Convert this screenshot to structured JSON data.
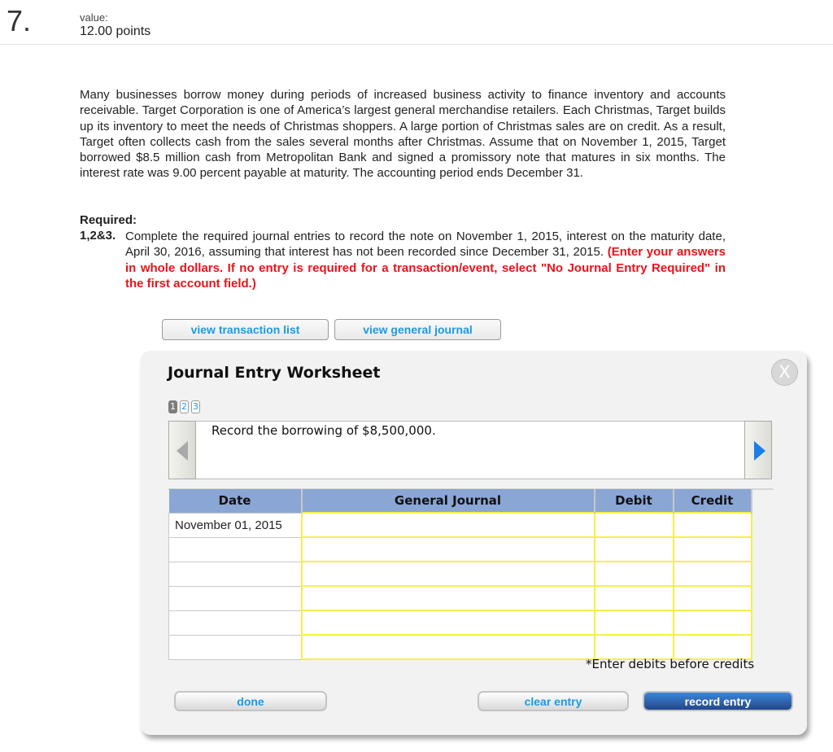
{
  "question": {
    "number": "7.",
    "value_label": "value:",
    "value_points": "12.00 points"
  },
  "problem_text": "Many businesses borrow money during periods of increased business activity to finance inventory and accounts receivable. Target Corporation is one of America’s largest general merchandise retailers. Each Christmas, Target builds up its inventory to meet the needs of Christmas shoppers. A large portion of Christmas sales are on credit. As a result, Target often collects cash from the sales several months after Christmas. Assume that on November 1, 2015, Target borrowed $8.5 million cash from Metropolitan Bank and signed a promissory note that matures in six months. The interest rate was 9.00 percent payable at maturity. The accounting period ends December 31.",
  "required": {
    "title": "Required:",
    "number": "1,2&3.",
    "text": "Complete the required journal entries to record the note on November 1, 2015, interest on the maturity date, April 30, 2016, assuming that interest has not been recorded since December 31, 2015. ",
    "instruction": "(Enter your answers in whole dollars. If no entry is required for a transaction/event, select \"No Journal Entry Required\" in the first account field.)"
  },
  "top_buttons": {
    "view_transaction_list": "view transaction list",
    "view_general_journal": "view general journal"
  },
  "worksheet": {
    "title": "Journal Entry Worksheet",
    "close_label": "X",
    "pages": [
      "1",
      "2",
      "3"
    ],
    "active_page": "1",
    "description": "Record the borrowing of $8,500,000.",
    "table": {
      "headers": [
        "Date",
        "General Journal",
        "Debit",
        "Credit"
      ],
      "rows": [
        {
          "date": "November 01, 2015",
          "account": "",
          "debit": "",
          "credit": ""
        },
        {
          "date": "",
          "account": "",
          "debit": "",
          "credit": ""
        },
        {
          "date": "",
          "account": "",
          "debit": "",
          "credit": ""
        },
        {
          "date": "",
          "account": "",
          "debit": "",
          "credit": ""
        },
        {
          "date": "",
          "account": "",
          "debit": "",
          "credit": ""
        },
        {
          "date": "",
          "account": "",
          "debit": "",
          "credit": ""
        }
      ]
    },
    "hint": "*Enter debits before credits",
    "buttons": {
      "done": "done",
      "clear_entry": "clear entry",
      "record_entry": "record entry"
    }
  },
  "colors": {
    "link_blue": "#1a9be6",
    "header_blue": "#8aa6d4",
    "instruction_red": "#e8141a",
    "input_border_yellow": "#f6f04a",
    "record_button_blue": "#24468a"
  }
}
